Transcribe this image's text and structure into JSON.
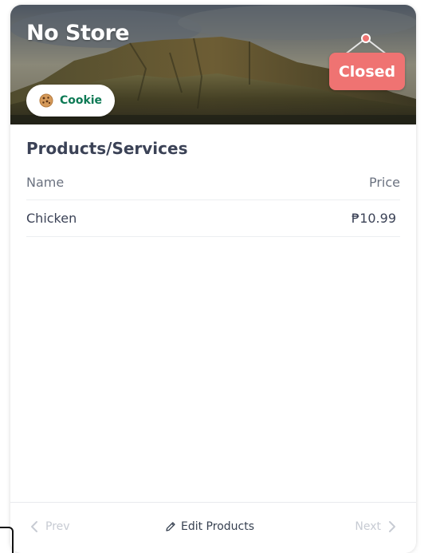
{
  "store": {
    "name": "No Store",
    "status": "Closed",
    "category": {
      "label": "Cookie",
      "icon": "cookie-icon"
    }
  },
  "products": {
    "title": "Products/Services",
    "columns": {
      "name": "Name",
      "price": "Price"
    },
    "rows": [
      {
        "name": "Chicken",
        "price": "₱10.99"
      }
    ]
  },
  "footer": {
    "prev_label": "Prev",
    "edit_label": "Edit Products",
    "next_label": "Next"
  },
  "colors": {
    "status_closed": "#ef7372",
    "category_text": "#0d7a55",
    "heading": "#3b4256",
    "muted": "#c7cbd3"
  }
}
